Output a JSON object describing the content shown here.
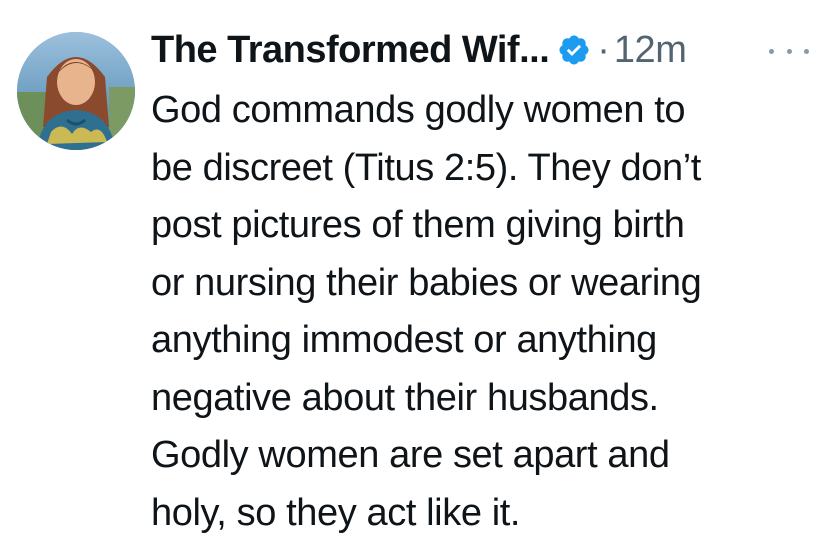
{
  "tweet": {
    "author": {
      "display_name": "The Transformed Wif...",
      "avatar_icon": "profile-photo",
      "verified_icon": "verified-badge-icon",
      "verified_color": "#1d9bf0"
    },
    "separator": "·",
    "timestamp": "12m",
    "more_icon": "more-horizontal-icon",
    "text_lines": [
      "God commands godly women to",
      "be discreet (Titus 2:5). They don’t",
      "post pictures of them giving birth",
      "or nursing their babies or wearing",
      "anything immodest or anything",
      "negative about their husbands.",
      "Godly women are set apart and",
      "holy, so they act like it."
    ]
  }
}
